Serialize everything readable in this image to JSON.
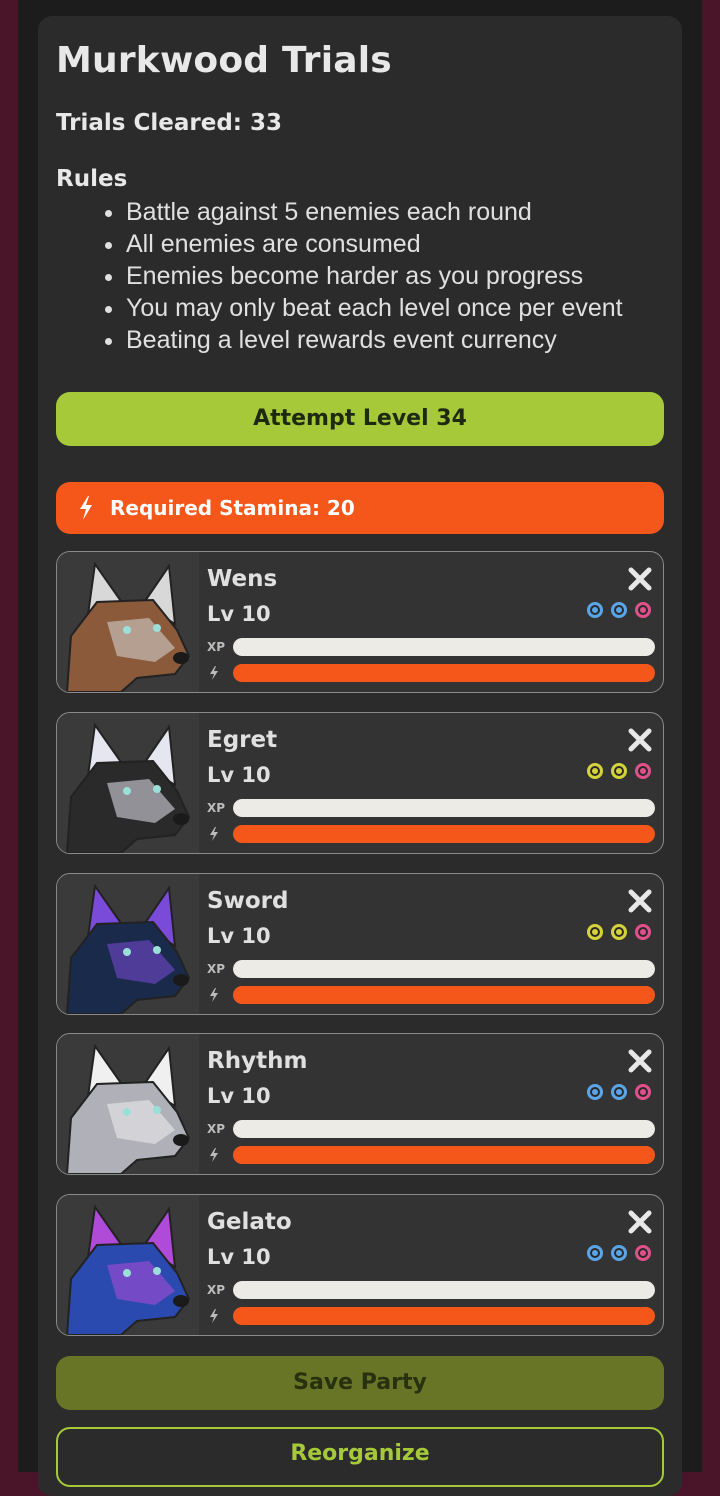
{
  "event": {
    "title": "Murkwood Trials",
    "cleared_label": "Trials Cleared: 33",
    "rules_title": "Rules",
    "rules": [
      "Battle against 5 enemies each round",
      "All enemies are consumed",
      "Enemies become harder as you progress",
      "You may only beat each level once per event",
      "Beating a level rewards event currency"
    ]
  },
  "attempt_button": "Attempt Level 34",
  "stamina": {
    "label": "Required Stamina: 20",
    "icon": "lightning-bolt-icon"
  },
  "party": [
    {
      "name": "Wens",
      "level": "Lv 10",
      "xp_fraction": 1.0,
      "stamina_fraction": 1.0,
      "traits": [
        "#5aa5e8",
        "#5aa5e8",
        "#e0508a"
      ],
      "coat": [
        "#8a5a3a",
        "#d8d8d8"
      ]
    },
    {
      "name": "Egret",
      "level": "Lv 10",
      "xp_fraction": 1.0,
      "stamina_fraction": 1.0,
      "traits": [
        "#d4d43a",
        "#d4d43a",
        "#e0508a"
      ],
      "coat": [
        "#2a2a2a",
        "#e6e6f0"
      ]
    },
    {
      "name": "Sword",
      "level": "Lv 10",
      "xp_fraction": 1.0,
      "stamina_fraction": 1.0,
      "traits": [
        "#d4d43a",
        "#d4d43a",
        "#e0508a"
      ],
      "coat": [
        "#1a2a4a",
        "#7a4ad8"
      ]
    },
    {
      "name": "Rhythm",
      "level": "Lv 10",
      "xp_fraction": 1.0,
      "stamina_fraction": 1.0,
      "traits": [
        "#5aa5e8",
        "#5aa5e8",
        "#e0508a"
      ],
      "coat": [
        "#b0b0b8",
        "#f0f0f0"
      ]
    },
    {
      "name": "Gelato",
      "level": "Lv 10",
      "xp_fraction": 1.0,
      "stamina_fraction": 1.0,
      "traits": [
        "#5aa5e8",
        "#5aa5e8",
        "#e0508a"
      ],
      "coat": [
        "#2a4ab0",
        "#b04ad8"
      ]
    }
  ],
  "labels": {
    "xp": "XP"
  },
  "save_button": "Save Party",
  "reorganize_button": "Reorganize",
  "colors": {
    "accent_green": "#a6c93a",
    "stamina_orange": "#f5561a",
    "background": "#4a1528"
  }
}
